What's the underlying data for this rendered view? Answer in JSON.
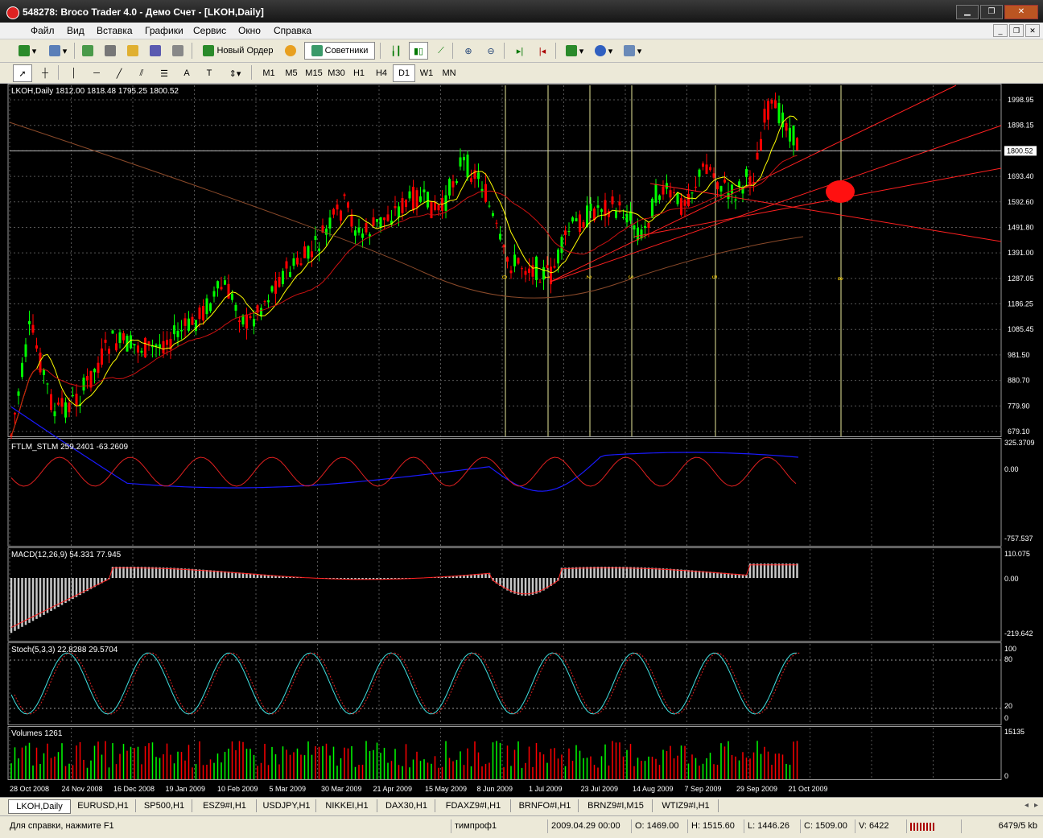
{
  "window": {
    "title": "548278: Broco Trader 4.0 - Демо Счет - [LKOH,Daily]"
  },
  "menu": [
    "Файл",
    "Вид",
    "Вставка",
    "Графики",
    "Сервис",
    "Окно",
    "Справка"
  ],
  "toolbar": {
    "new_order": "Новый Ордер",
    "advisors": "Советники"
  },
  "timeframes": [
    "M1",
    "M5",
    "M15",
    "M30",
    "H1",
    "H4",
    "D1",
    "W1",
    "MN"
  ],
  "active_timeframe": "D1",
  "chart": {
    "header": "LKOH,Daily  1812.00 1818.48 1795.25 1800.52",
    "price_labels": [
      "1998.95",
      "1898.15",
      "1800.52",
      "1693.40",
      "1592.60",
      "1491.80",
      "1391.00",
      "1287.05",
      "1186.25",
      "1085.45",
      "981.50",
      "880.70",
      "779.90",
      "679.10"
    ],
    "current_price": "1800.52",
    "fib_labels": [
      "0",
      "1",
      "2",
      "3",
      "5",
      "8"
    ],
    "dates": [
      "28 Oct 2008",
      "24 Nov 2008",
      "16 Dec 2008",
      "19 Jan 2009",
      "10 Feb 2009",
      "5 Mar 2009",
      "30 Mar 2009",
      "21 Apr 2009",
      "15 May 2009",
      "8 Jun 2009",
      "1 Jul 2009",
      "23 Jul 2009",
      "14 Aug 2009",
      "7 Sep 2009",
      "29 Sep 2009",
      "21 Oct 2009"
    ]
  },
  "indicators": {
    "ftlm": {
      "label": "FTLM_STLM 259.2401 -63.2609",
      "scale": [
        "325.3709",
        "0.00",
        "-757.537"
      ]
    },
    "macd": {
      "label": "MACD(12,26,9) 54.331 77.945",
      "scale": [
        "110.075",
        "0.00",
        "-219.642"
      ]
    },
    "stoch": {
      "label": "Stoch(5,3,3) 22.8288 29.5704",
      "scale": [
        "100",
        "80",
        "20",
        "0"
      ]
    },
    "volumes": {
      "label": "Volumes 1261",
      "scale": [
        "15135",
        "0"
      ]
    }
  },
  "tabs": [
    "LKOH,Daily",
    "EURUSD,H1",
    "SP500,H1",
    "ESZ9#I,H1",
    "USDJPY,H1",
    "NIKKEI,H1",
    "DAX30,H1",
    "FDAXZ9#I,H1",
    "BRNFO#I,H1",
    "BRNZ9#I,M15",
    "WTIZ9#I,H1"
  ],
  "status": {
    "help": "Для справки, нажмите F1",
    "profile": "тимпроф1",
    "datetime": "2009.04.29 00:00",
    "open": "O: 1469.00",
    "high": "H: 1515.60",
    "low": "L: 1446.26",
    "close": "C: 1509.00",
    "volume": "V: 6422",
    "traffic": "6479/5 kb"
  },
  "colors": {
    "bull": "#00ff00",
    "bear": "#ff0000",
    "ma_fast": "#ffff00",
    "ma_slow": "#cc1111",
    "ma_long": "#8b4a2a",
    "signal_blue": "#1a1aff",
    "grid": "#555555"
  }
}
